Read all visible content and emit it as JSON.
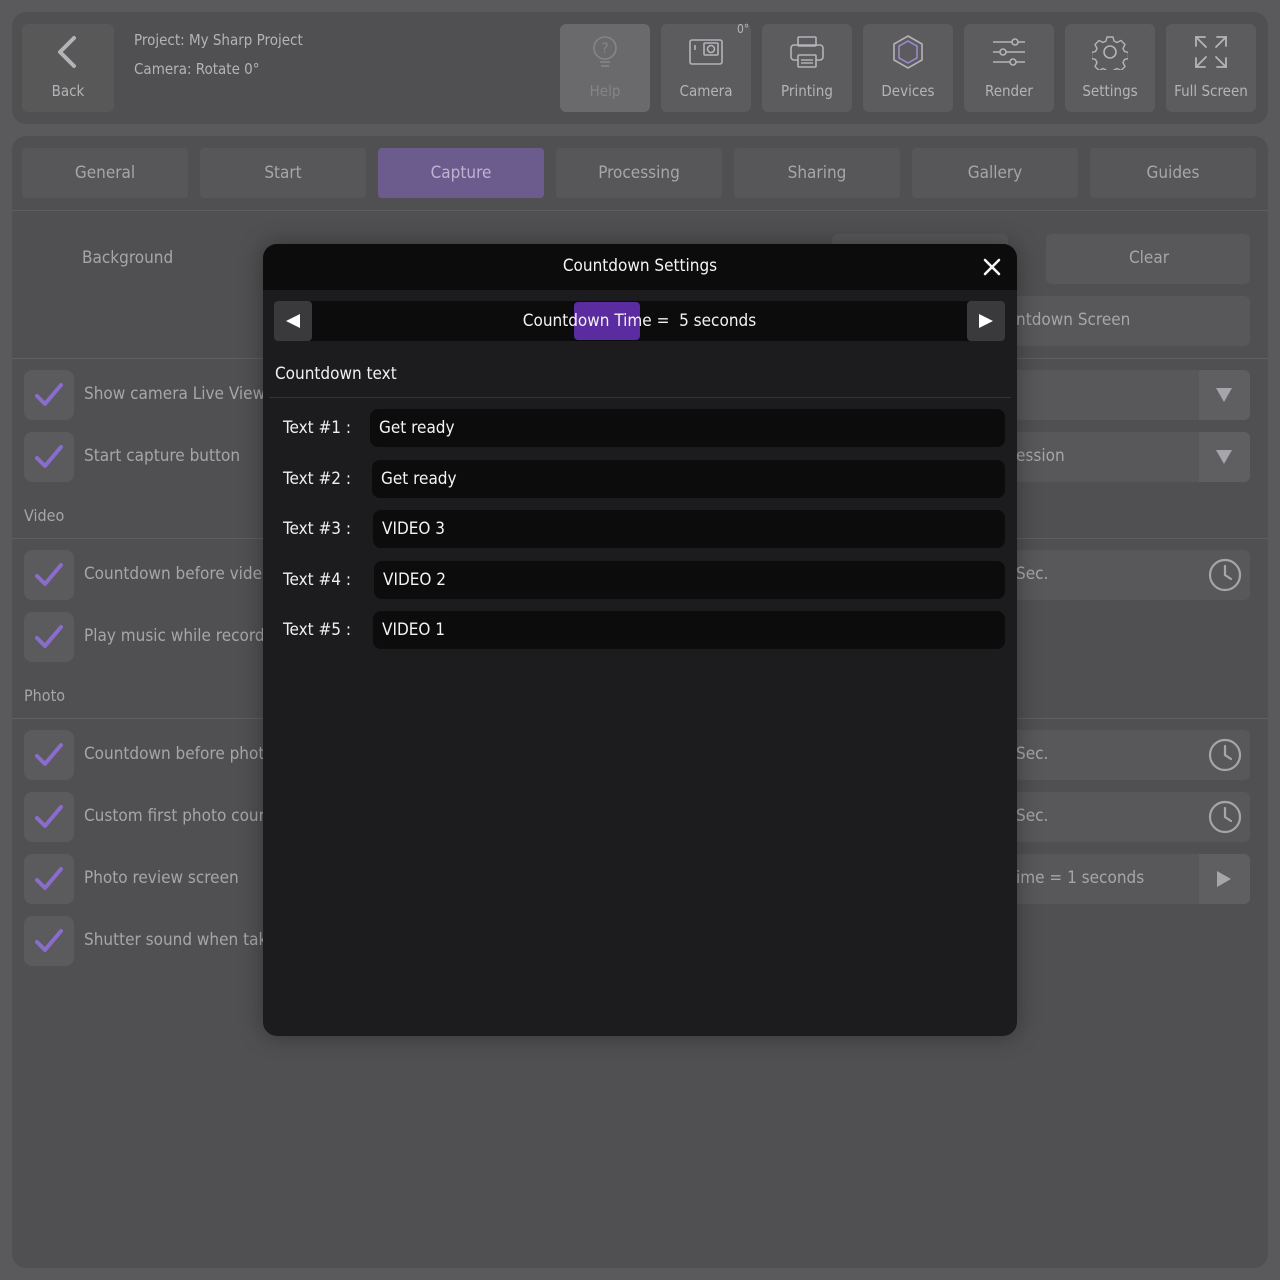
{
  "header": {
    "back_label": "Back",
    "project_line": "Project: My Sharp Project",
    "camera_line": "Camera: Rotate 0°",
    "camera_rotation_badge": "0°",
    "tools": [
      {
        "label": "Help",
        "icon": "lightbulb-icon"
      },
      {
        "label": "Camera",
        "icon": "camera-icon"
      },
      {
        "label": "Printing",
        "icon": "printer-icon"
      },
      {
        "label": "Devices",
        "icon": "devices-icon"
      },
      {
        "label": "Render",
        "icon": "sliders-icon"
      },
      {
        "label": "Settings",
        "icon": "gear-icon"
      },
      {
        "label": "Full Screen",
        "icon": "fullscreen-icon"
      }
    ]
  },
  "tabs": [
    "General",
    "Start",
    "Capture",
    "Processing",
    "Sharing",
    "Gallery",
    "Guides"
  ],
  "active_tab": "Capture",
  "background_section": {
    "label": "Background",
    "clear_label": "Clear",
    "countdown_screen_partial": "ntdown Screen"
  },
  "options": {
    "show_live_view": "Show camera Live View",
    "start_capture_button": "Start capture button",
    "start_capture_right": "ession",
    "video_section": "Video",
    "countdown_before_video": "Countdown before vide",
    "countdown_video_right": "Sec.",
    "play_music": "Play music while record",
    "photo_section": "Photo",
    "countdown_before_photo": "Countdown before phot",
    "countdown_photo_right": "Sec.",
    "custom_first_photo": "Custom first photo cour",
    "custom_first_right": "Sec.",
    "photo_review": "Photo review screen",
    "photo_review_right": "ime = 1 seconds",
    "shutter_sound": "Shutter sound when tak"
  },
  "modal": {
    "title": "Countdown Settings",
    "countdown_time": "Countdown Time =  5 seconds",
    "section_title": "Countdown text",
    "fields": [
      {
        "label": "Text #1 :",
        "value": "Get ready"
      },
      {
        "label": "Text #2 :",
        "value": "Get ready"
      },
      {
        "label": "Text #3 :",
        "value": "VIDEO 3"
      },
      {
        "label": "Text #4 :",
        "value": "VIDEO 2"
      },
      {
        "label": "Text #5 :",
        "value": "VIDEO 1"
      }
    ]
  },
  "colors": {
    "accent": "#5b2ba0",
    "check": "#8a6ccf",
    "modal_bg": "#1c1c1e"
  }
}
